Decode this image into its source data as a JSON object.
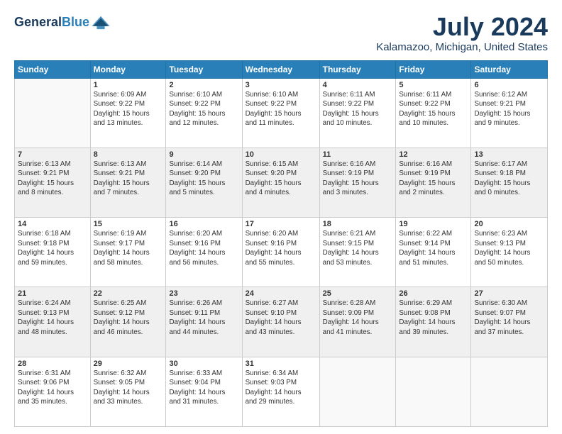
{
  "header": {
    "logo_line1": "General",
    "logo_line2": "Blue",
    "title": "July 2024",
    "subtitle": "Kalamazoo, Michigan, United States"
  },
  "weekdays": [
    "Sunday",
    "Monday",
    "Tuesday",
    "Wednesday",
    "Thursday",
    "Friday",
    "Saturday"
  ],
  "weeks": [
    [
      {
        "day": "",
        "info": ""
      },
      {
        "day": "1",
        "info": "Sunrise: 6:09 AM\nSunset: 9:22 PM\nDaylight: 15 hours\nand 13 minutes."
      },
      {
        "day": "2",
        "info": "Sunrise: 6:10 AM\nSunset: 9:22 PM\nDaylight: 15 hours\nand 12 minutes."
      },
      {
        "day": "3",
        "info": "Sunrise: 6:10 AM\nSunset: 9:22 PM\nDaylight: 15 hours\nand 11 minutes."
      },
      {
        "day": "4",
        "info": "Sunrise: 6:11 AM\nSunset: 9:22 PM\nDaylight: 15 hours\nand 10 minutes."
      },
      {
        "day": "5",
        "info": "Sunrise: 6:11 AM\nSunset: 9:22 PM\nDaylight: 15 hours\nand 10 minutes."
      },
      {
        "day": "6",
        "info": "Sunrise: 6:12 AM\nSunset: 9:21 PM\nDaylight: 15 hours\nand 9 minutes."
      }
    ],
    [
      {
        "day": "7",
        "info": "Sunrise: 6:13 AM\nSunset: 9:21 PM\nDaylight: 15 hours\nand 8 minutes."
      },
      {
        "day": "8",
        "info": "Sunrise: 6:13 AM\nSunset: 9:21 PM\nDaylight: 15 hours\nand 7 minutes."
      },
      {
        "day": "9",
        "info": "Sunrise: 6:14 AM\nSunset: 9:20 PM\nDaylight: 15 hours\nand 5 minutes."
      },
      {
        "day": "10",
        "info": "Sunrise: 6:15 AM\nSunset: 9:20 PM\nDaylight: 15 hours\nand 4 minutes."
      },
      {
        "day": "11",
        "info": "Sunrise: 6:16 AM\nSunset: 9:19 PM\nDaylight: 15 hours\nand 3 minutes."
      },
      {
        "day": "12",
        "info": "Sunrise: 6:16 AM\nSunset: 9:19 PM\nDaylight: 15 hours\nand 2 minutes."
      },
      {
        "day": "13",
        "info": "Sunrise: 6:17 AM\nSunset: 9:18 PM\nDaylight: 15 hours\nand 0 minutes."
      }
    ],
    [
      {
        "day": "14",
        "info": "Sunrise: 6:18 AM\nSunset: 9:18 PM\nDaylight: 14 hours\nand 59 minutes."
      },
      {
        "day": "15",
        "info": "Sunrise: 6:19 AM\nSunset: 9:17 PM\nDaylight: 14 hours\nand 58 minutes."
      },
      {
        "day": "16",
        "info": "Sunrise: 6:20 AM\nSunset: 9:16 PM\nDaylight: 14 hours\nand 56 minutes."
      },
      {
        "day": "17",
        "info": "Sunrise: 6:20 AM\nSunset: 9:16 PM\nDaylight: 14 hours\nand 55 minutes."
      },
      {
        "day": "18",
        "info": "Sunrise: 6:21 AM\nSunset: 9:15 PM\nDaylight: 14 hours\nand 53 minutes."
      },
      {
        "day": "19",
        "info": "Sunrise: 6:22 AM\nSunset: 9:14 PM\nDaylight: 14 hours\nand 51 minutes."
      },
      {
        "day": "20",
        "info": "Sunrise: 6:23 AM\nSunset: 9:13 PM\nDaylight: 14 hours\nand 50 minutes."
      }
    ],
    [
      {
        "day": "21",
        "info": "Sunrise: 6:24 AM\nSunset: 9:13 PM\nDaylight: 14 hours\nand 48 minutes."
      },
      {
        "day": "22",
        "info": "Sunrise: 6:25 AM\nSunset: 9:12 PM\nDaylight: 14 hours\nand 46 minutes."
      },
      {
        "day": "23",
        "info": "Sunrise: 6:26 AM\nSunset: 9:11 PM\nDaylight: 14 hours\nand 44 minutes."
      },
      {
        "day": "24",
        "info": "Sunrise: 6:27 AM\nSunset: 9:10 PM\nDaylight: 14 hours\nand 43 minutes."
      },
      {
        "day": "25",
        "info": "Sunrise: 6:28 AM\nSunset: 9:09 PM\nDaylight: 14 hours\nand 41 minutes."
      },
      {
        "day": "26",
        "info": "Sunrise: 6:29 AM\nSunset: 9:08 PM\nDaylight: 14 hours\nand 39 minutes."
      },
      {
        "day": "27",
        "info": "Sunrise: 6:30 AM\nSunset: 9:07 PM\nDaylight: 14 hours\nand 37 minutes."
      }
    ],
    [
      {
        "day": "28",
        "info": "Sunrise: 6:31 AM\nSunset: 9:06 PM\nDaylight: 14 hours\nand 35 minutes."
      },
      {
        "day": "29",
        "info": "Sunrise: 6:32 AM\nSunset: 9:05 PM\nDaylight: 14 hours\nand 33 minutes."
      },
      {
        "day": "30",
        "info": "Sunrise: 6:33 AM\nSunset: 9:04 PM\nDaylight: 14 hours\nand 31 minutes."
      },
      {
        "day": "31",
        "info": "Sunrise: 6:34 AM\nSunset: 9:03 PM\nDaylight: 14 hours\nand 29 minutes."
      },
      {
        "day": "",
        "info": ""
      },
      {
        "day": "",
        "info": ""
      },
      {
        "day": "",
        "info": ""
      }
    ]
  ]
}
